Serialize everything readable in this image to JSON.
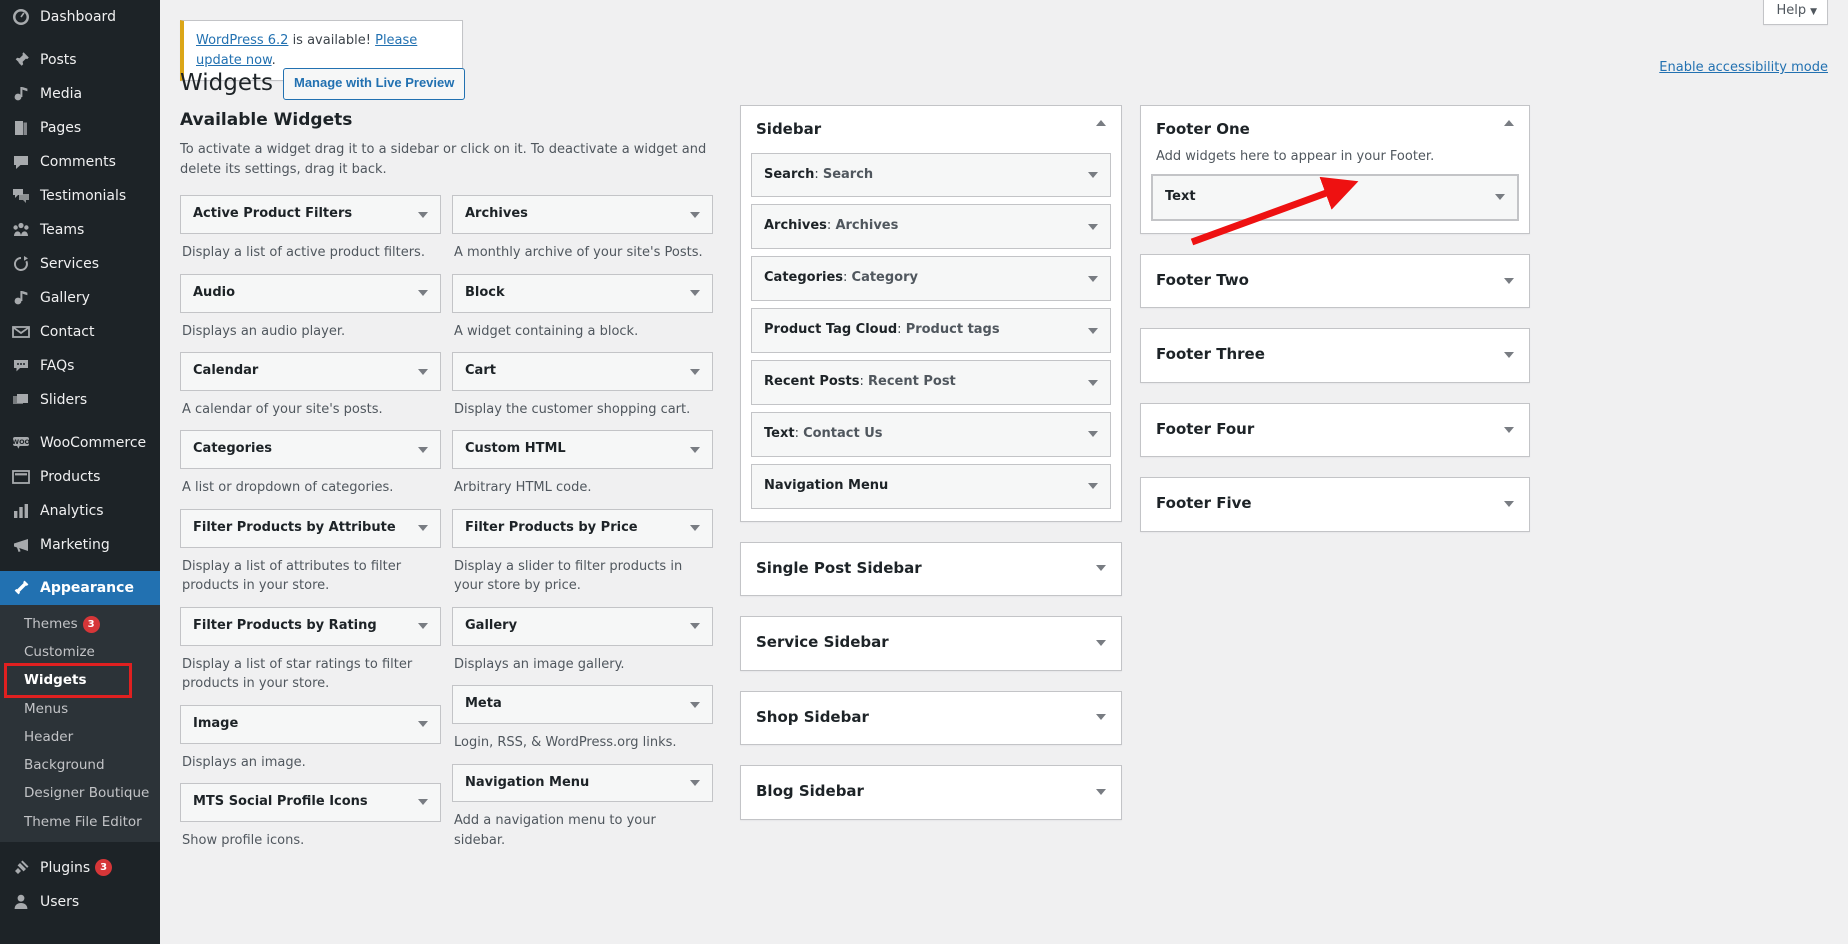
{
  "admin_menu": {
    "items": [
      {
        "label": "Dashboard",
        "icon": "dashboard-icon",
        "name": "sidebar-item-dashboard"
      },
      {
        "label": "Posts",
        "icon": "pin-icon",
        "name": "sidebar-item-posts",
        "gap": true
      },
      {
        "label": "Media",
        "icon": "media-icon",
        "name": "sidebar-item-media"
      },
      {
        "label": "Pages",
        "icon": "pages-icon",
        "name": "sidebar-item-pages"
      },
      {
        "label": "Comments",
        "icon": "comments-icon",
        "name": "sidebar-item-comments"
      },
      {
        "label": "Testimonials",
        "icon": "testimonials-icon",
        "name": "sidebar-item-testimonials"
      },
      {
        "label": "Teams",
        "icon": "teams-icon",
        "name": "sidebar-item-teams"
      },
      {
        "label": "Services",
        "icon": "services-icon",
        "name": "sidebar-item-services"
      },
      {
        "label": "Gallery",
        "icon": "gallery-icon",
        "name": "sidebar-item-gallery"
      },
      {
        "label": "Contact",
        "icon": "envelope-icon",
        "name": "sidebar-item-contact"
      },
      {
        "label": "FAQs",
        "icon": "faq-icon",
        "name": "sidebar-item-faqs"
      },
      {
        "label": "Sliders",
        "icon": "sliders-icon",
        "name": "sidebar-item-sliders"
      },
      {
        "label": "WooCommerce",
        "icon": "woocommerce-icon",
        "name": "sidebar-item-woocommerce",
        "gap": true
      },
      {
        "label": "Products",
        "icon": "products-icon",
        "name": "sidebar-item-products"
      },
      {
        "label": "Analytics",
        "icon": "analytics-icon",
        "name": "sidebar-item-analytics"
      },
      {
        "label": "Marketing",
        "icon": "marketing-icon",
        "name": "sidebar-item-marketing"
      },
      {
        "label": "Appearance",
        "icon": "appearance-icon",
        "name": "sidebar-item-appearance",
        "current": true,
        "gap": true
      }
    ],
    "appearance_submenu": [
      {
        "label": "Themes",
        "badge": "3",
        "name": "submenu-item-themes"
      },
      {
        "label": "Customize",
        "name": "submenu-item-customize"
      },
      {
        "label": "Widgets",
        "current": true,
        "name": "submenu-item-widgets"
      },
      {
        "label": "Menus",
        "name": "submenu-item-menus"
      },
      {
        "label": "Header",
        "name": "submenu-item-header"
      },
      {
        "label": "Background",
        "name": "submenu-item-background"
      },
      {
        "label": "Designer Boutique",
        "name": "submenu-item-designer-boutique"
      },
      {
        "label": "Theme File Editor",
        "name": "submenu-item-theme-file-editor"
      }
    ],
    "bottom_items": [
      {
        "label": "Plugins",
        "icon": "plugins-icon",
        "badge": "3",
        "name": "sidebar-item-plugins"
      },
      {
        "label": "Users",
        "icon": "users-icon",
        "name": "sidebar-item-users"
      }
    ]
  },
  "header": {
    "help_label": "Help",
    "help_caret": "▼",
    "notice": {
      "link_version": "WordPress 6.2",
      "mid_text": " is available! ",
      "link_update": "Please update now",
      "end_text": "."
    },
    "page_title": "Widgets",
    "live_preview_button": "Manage with Live Preview",
    "accessibility_link": "Enable accessibility mode"
  },
  "available_widgets": {
    "heading": "Available Widgets",
    "description": "To activate a widget drag it to a sidebar or click on it. To deactivate a widget and delete its settings, drag it back.",
    "column_left": [
      {
        "title": "Active Product Filters",
        "desc": "Display a list of active product filters."
      },
      {
        "title": "Audio",
        "desc": "Displays an audio player."
      },
      {
        "title": "Calendar",
        "desc": "A calendar of your site's posts."
      },
      {
        "title": "Categories",
        "desc": "A list or dropdown of categories."
      },
      {
        "title": "Filter Products by Attribute",
        "desc": "Display a list of attributes to filter products in your store."
      },
      {
        "title": "Filter Products by Rating",
        "desc": "Display a list of star ratings to filter products in your store."
      },
      {
        "title": "Image",
        "desc": "Displays an image."
      },
      {
        "title": "MTS Social Profile Icons",
        "desc": "Show profile icons."
      }
    ],
    "column_right": [
      {
        "title": "Archives",
        "desc": "A monthly archive of your site's Posts."
      },
      {
        "title": "Block",
        "desc": "A widget containing a block."
      },
      {
        "title": "Cart",
        "desc": "Display the customer shopping cart."
      },
      {
        "title": "Custom HTML",
        "desc": "Arbitrary HTML code."
      },
      {
        "title": "Filter Products by Price",
        "desc": "Display a slider to filter products in your store by price."
      },
      {
        "title": "Gallery",
        "desc": "Displays an image gallery."
      },
      {
        "title": "Meta",
        "desc": "Login, RSS, & WordPress.org links."
      },
      {
        "title": "Navigation Menu",
        "desc": "Add a navigation menu to your sidebar."
      }
    ]
  },
  "sidebars_mid": [
    {
      "title": "Sidebar",
      "expanded": true,
      "widgets": [
        {
          "type": "Search",
          "value": "Search"
        },
        {
          "type": "Archives",
          "value": "Archives"
        },
        {
          "type": "Categories",
          "value": "Category"
        },
        {
          "type": "Product Tag Cloud",
          "value": "Product tags"
        },
        {
          "type": "Recent Posts",
          "value": "Recent Post"
        },
        {
          "type": "Text",
          "value": "Contact Us"
        },
        {
          "type": "Navigation Menu",
          "value": ""
        }
      ]
    },
    {
      "title": "Single Post Sidebar",
      "expanded": false,
      "widgets": []
    },
    {
      "title": "Service Sidebar",
      "expanded": false,
      "widgets": []
    },
    {
      "title": "Shop Sidebar",
      "expanded": false,
      "widgets": []
    },
    {
      "title": "Blog Sidebar",
      "expanded": false,
      "widgets": []
    }
  ],
  "sidebars_right": [
    {
      "title": "Footer One",
      "expanded": true,
      "sub": "Add widgets here to appear in your Footer.",
      "widgets": [
        {
          "type": "Text",
          "value": "",
          "highlight": true
        }
      ]
    },
    {
      "title": "Footer Two",
      "expanded": false,
      "widgets": []
    },
    {
      "title": "Footer Three",
      "expanded": false,
      "widgets": []
    },
    {
      "title": "Footer Four",
      "expanded": false,
      "widgets": []
    },
    {
      "title": "Footer Five",
      "expanded": false,
      "widgets": []
    }
  ],
  "annotations": {
    "arrow_color": "#ee1111",
    "highlight_color": "#e02020",
    "arrow_target": "Text widget in Footer One",
    "highlight_target": "Widgets menu item"
  }
}
